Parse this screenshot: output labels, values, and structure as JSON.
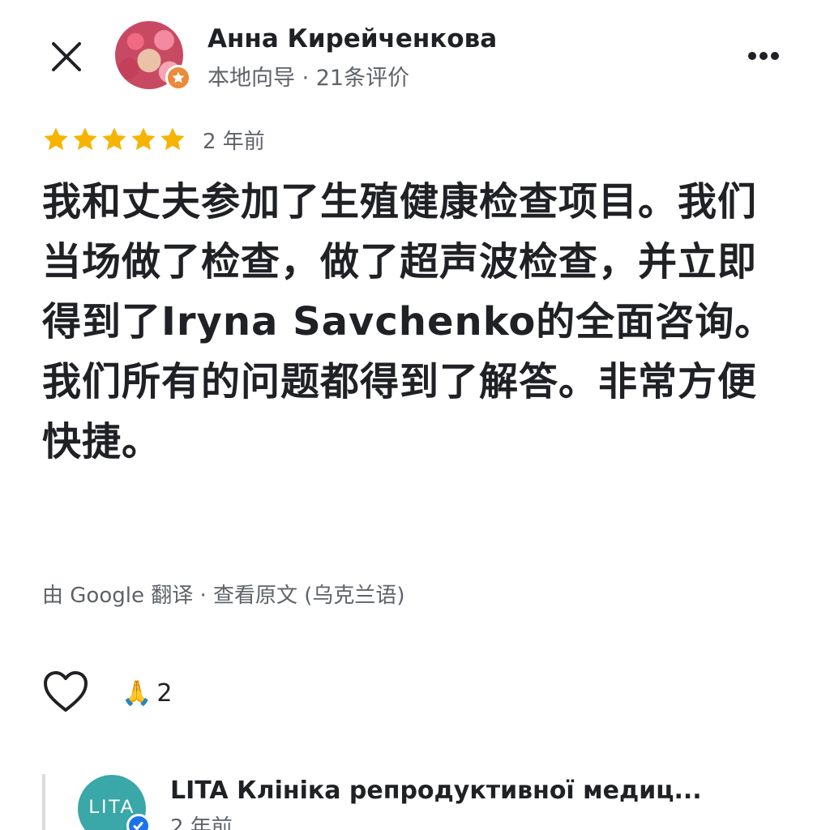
{
  "header": {
    "author_name": "Анна Кирейченкова",
    "author_meta": "本地向导 · 21条评价"
  },
  "review": {
    "rating": 5,
    "max_rating": 5,
    "time_ago": "2 年前",
    "text": "我和丈夫参加了生殖健康检查项目。我们当场做了检查，做了超声波检查，并立即得到了Iryna Savchenko的全面咨询。我们所有的问题都得到了解答。非常方便快捷。",
    "translation_note": "由 Google 翻译 · 查看原文 (乌克兰语)"
  },
  "actions": {
    "reaction_emoji": "🙏",
    "reaction_count": "2"
  },
  "owner_reply": {
    "name": "LITA Клініка репродуктивної медиц...",
    "time_ago": "2 年前",
    "logo_text": "LITA"
  },
  "colors": {
    "star": "#f6b400",
    "guide_badge": "#ea8a3a",
    "owner_brand": "#3aa7a8",
    "verified": "#1a73e8"
  },
  "icons": {
    "close": "close-icon",
    "more": "more-horiz-icon",
    "like": "heart-outline-icon",
    "guide": "star-badge-icon",
    "verified": "verified-check-icon"
  }
}
